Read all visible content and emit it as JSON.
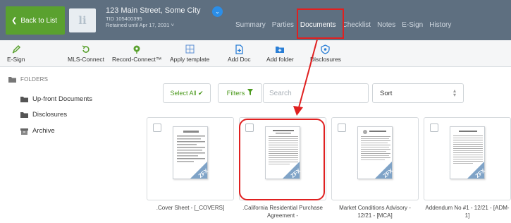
{
  "header": {
    "back_label": "Back to List",
    "logo_text": "li",
    "address": "123 Main Street, Some City",
    "tid": "TID 105400395",
    "retained": "Retained until Apr 17, 2031 ˅",
    "tabs": [
      {
        "label": "Summary"
      },
      {
        "label": "Parties"
      },
      {
        "label": "Documents",
        "active": true
      },
      {
        "label": "Checklist"
      },
      {
        "label": "Notes"
      },
      {
        "label": "E-Sign"
      },
      {
        "label": "History"
      }
    ]
  },
  "toolbar": {
    "items": [
      {
        "label": "E-Sign",
        "icon": "pen-icon"
      },
      {
        "label": "MLS-Connect",
        "icon": "refresh-icon"
      },
      {
        "label": "Record-Connect™",
        "icon": "record-icon"
      },
      {
        "label": "Apply template",
        "icon": "grid-icon"
      },
      {
        "label": "Add Doc",
        "icon": "add-doc-icon"
      },
      {
        "label": "Add folder",
        "icon": "add-folder-icon"
      },
      {
        "label": "Disclosures",
        "icon": "shield-icon"
      }
    ]
  },
  "sidebar": {
    "header": "FOLDERS",
    "items": [
      {
        "label": "Up-front Documents"
      },
      {
        "label": "Disclosures"
      },
      {
        "label": "Archive"
      }
    ]
  },
  "content": {
    "select_all_label": "Select All ✔",
    "filters_label": "Filters",
    "search_placeholder": "Search",
    "sort_label": "Sort",
    "documents": [
      {
        "title": ".Cover Sheet - [_COVERS]",
        "badge": "ZFX"
      },
      {
        "title": ".California Residential Purchase Agreement -",
        "badge": "ZFX"
      },
      {
        "title": "Market Conditions Advisory - 12/21 - [MCA]",
        "badge": "ZFX"
      },
      {
        "title": "Addendum No #1 - 12/21 - [ADM-1]",
        "badge": "ZFX"
      }
    ]
  },
  "colors": {
    "header_bg": "#5e6f80",
    "back_button": "#5aa12f",
    "accent_green": "#4c9a1e",
    "annotation_red": "#e02020",
    "dropdown_blue": "#2b8ee8"
  }
}
